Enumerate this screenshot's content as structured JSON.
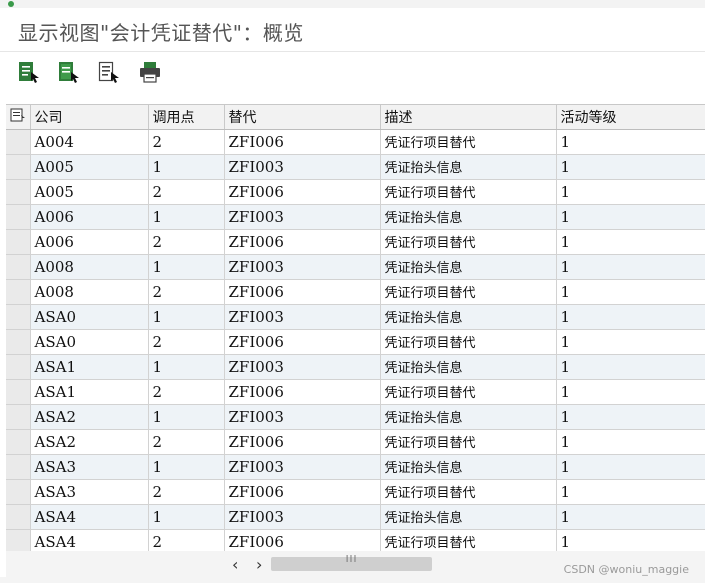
{
  "window": {
    "title": "显示视图\"会计凭证替代\"：概览"
  },
  "toolbar": {
    "buttons": [
      {
        "name": "details-button",
        "icon": "details-icon"
      },
      {
        "name": "select-all-button",
        "icon": "select-all-icon"
      },
      {
        "name": "deselect-all-button",
        "icon": "deselect-all-icon"
      },
      {
        "name": "print-button",
        "icon": "printer-icon"
      }
    ]
  },
  "table": {
    "columns": [
      "公司",
      "调用点",
      "替代",
      "描述",
      "活动等级"
    ],
    "rows": [
      [
        "A004",
        "2",
        "ZFI006",
        "凭证行项目替代",
        "1"
      ],
      [
        "A005",
        "1",
        "ZFI003",
        "凭证抬头信息",
        "1"
      ],
      [
        "A005",
        "2",
        "ZFI006",
        "凭证行项目替代",
        "1"
      ],
      [
        "A006",
        "1",
        "ZFI003",
        "凭证抬头信息",
        "1"
      ],
      [
        "A006",
        "2",
        "ZFI006",
        "凭证行项目替代",
        "1"
      ],
      [
        "A008",
        "1",
        "ZFI003",
        "凭证抬头信息",
        "1"
      ],
      [
        "A008",
        "2",
        "ZFI006",
        "凭证行项目替代",
        "1"
      ],
      [
        "ASA0",
        "1",
        "ZFI003",
        "凭证抬头信息",
        "1"
      ],
      [
        "ASA0",
        "2",
        "ZFI006",
        "凭证行项目替代",
        "1"
      ],
      [
        "ASA1",
        "1",
        "ZFI003",
        "凭证抬头信息",
        "1"
      ],
      [
        "ASA1",
        "2",
        "ZFI006",
        "凭证行项目替代",
        "1"
      ],
      [
        "ASA2",
        "1",
        "ZFI003",
        "凭证抬头信息",
        "1"
      ],
      [
        "ASA2",
        "2",
        "ZFI006",
        "凭证行项目替代",
        "1"
      ],
      [
        "ASA3",
        "1",
        "ZFI003",
        "凭证抬头信息",
        "1"
      ],
      [
        "ASA3",
        "2",
        "ZFI006",
        "凭证行项目替代",
        "1"
      ],
      [
        "ASA4",
        "1",
        "ZFI003",
        "凭证抬头信息",
        "1"
      ],
      [
        "ASA4",
        "2",
        "ZFI006",
        "凭证行项目替代",
        "1"
      ]
    ]
  },
  "scrollbar": {
    "left_arrow": "‹",
    "right_arrow": "›",
    "grip": "III"
  },
  "watermark": {
    "text": "CSDN @woniu_maggie"
  },
  "colors": {
    "icon_green": "#2f7d3a",
    "icon_gray": "#444444",
    "row_alt": "#eef3f7",
    "header_bg": "#f2f2f2"
  }
}
